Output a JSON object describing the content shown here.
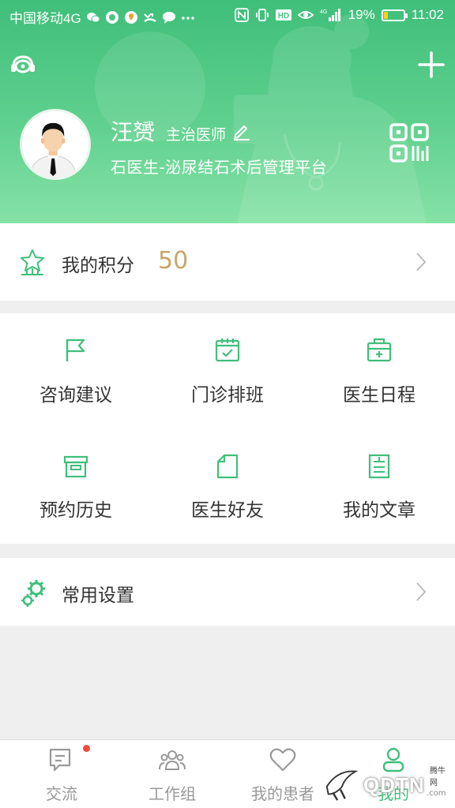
{
  "status_bar": {
    "carrier": "中国移动4G",
    "battery": "19%",
    "battery_level": 0.19,
    "time": "11:02",
    "icons": [
      "wechat-icon",
      "app-icon",
      "location-icon",
      "missed-call-icon",
      "message-icon",
      "more-icon",
      "nfc-icon",
      "vibrate-icon",
      "hd-icon",
      "eye-icon",
      "signal-icon",
      "battery-icon"
    ]
  },
  "header": {
    "left_icon": "headset-service-icon",
    "right_icon": "plus-icon",
    "doctor_name": "汪赟",
    "doctor_title": "主治医师",
    "platform": "石医生-泌尿结石术后管理平台",
    "qr_icon": "qr-code-icon"
  },
  "points": {
    "label": "我的积分",
    "value": "50",
    "icon": "star-points-icon"
  },
  "grid": {
    "items": [
      {
        "label": "咨询建议",
        "icon": "flag-icon"
      },
      {
        "label": "门诊排班",
        "icon": "calendar-icon"
      },
      {
        "label": "医生日程",
        "icon": "medical-kit-icon"
      },
      {
        "label": "预约历史",
        "icon": "archive-box-icon"
      },
      {
        "label": "医生好友",
        "icon": "document-icon"
      },
      {
        "label": "我的文章",
        "icon": "article-icon"
      }
    ]
  },
  "settings": {
    "label": "常用设置",
    "icon": "gears-icon"
  },
  "tabbar": {
    "tabs": [
      {
        "label": "交流",
        "icon": "chat-icon",
        "active": false,
        "badge": true
      },
      {
        "label": "工作组",
        "icon": "group-icon",
        "active": false
      },
      {
        "label": "我的患者",
        "icon": "heart-icon",
        "active": false
      },
      {
        "label": "我的",
        "icon": "person-icon",
        "active": true
      }
    ]
  },
  "watermark": {
    "text": "QDTN",
    "small": "腾牛网",
    "domain": ".com"
  },
  "colors": {
    "brand_green": "#3fbf7a",
    "points_gold": "#c9a567",
    "badge_red": "#ef4a3a"
  }
}
